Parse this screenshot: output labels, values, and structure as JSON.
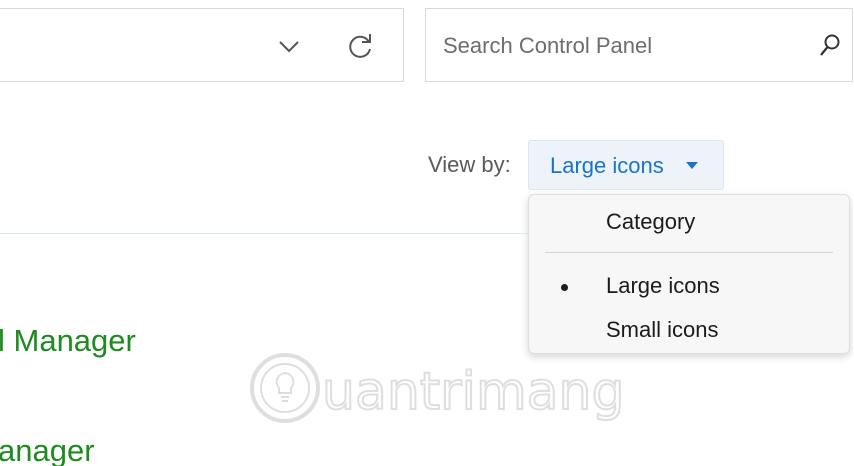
{
  "search": {
    "placeholder": "Search Control Panel"
  },
  "icons": {
    "address_dropdown": "chevron-down-icon",
    "refresh": "refresh-icon",
    "search": "search-icon",
    "view_caret": "caret-down-icon"
  },
  "view_by": {
    "label": "View by:",
    "selected": "Large icons"
  },
  "dropdown": {
    "items": [
      {
        "label": "Category",
        "selected": false
      },
      {
        "label": "Large icons",
        "selected": true
      },
      {
        "label": "Small icons",
        "selected": false
      }
    ]
  },
  "content": {
    "links": [
      {
        "label": "l Manager"
      },
      {
        "label": "anager"
      }
    ]
  },
  "watermark": {
    "text": "uantrimang"
  },
  "colors": {
    "accent": "#1a73c8",
    "link_green": "#1f8a1f"
  }
}
